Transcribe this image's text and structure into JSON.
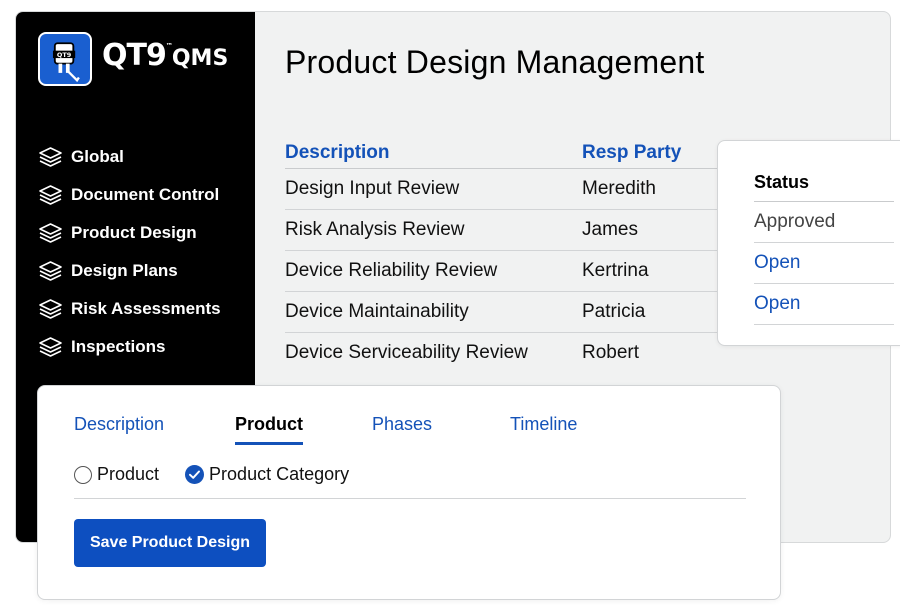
{
  "brand": {
    "logo_name": "QT9",
    "logo_suffix": "QMS",
    "trademark": "™",
    "badge_text": "QT9",
    "accent_color": "#1a5fd0"
  },
  "sidebar": {
    "items": [
      {
        "label": "Global",
        "icon": "layers-icon"
      },
      {
        "label": "Document Control",
        "icon": "layers-icon"
      },
      {
        "label": "Product Design",
        "icon": "layers-icon"
      },
      {
        "label": "Design Plans",
        "icon": "layers-icon"
      },
      {
        "label": "Risk Assessments",
        "icon": "layers-icon"
      },
      {
        "label": "Inspections",
        "icon": "layers-icon"
      }
    ]
  },
  "main": {
    "title": "Product Design Management",
    "table": {
      "headers": [
        "Description",
        "Resp Party"
      ],
      "rows": [
        {
          "description": "Design Input Review",
          "resp_party": "Meredith"
        },
        {
          "description": "Risk Analysis Review",
          "resp_party": "James"
        },
        {
          "description": "Device Reliability Review",
          "resp_party": "Kertrina"
        },
        {
          "description": "Device Maintainability",
          "resp_party": "Patricia"
        },
        {
          "description": "Device Serviceability Review",
          "resp_party": "Robert"
        }
      ]
    }
  },
  "status_panel": {
    "header": "Status",
    "items": [
      "Approved",
      "Open",
      "Open"
    ]
  },
  "bottom_panel": {
    "tabs": [
      {
        "label": "Description",
        "active": false
      },
      {
        "label": "Product",
        "active": true
      },
      {
        "label": "Phases",
        "active": false
      },
      {
        "label": "Timeline",
        "active": false
      }
    ],
    "radios": [
      {
        "label": "Product",
        "checked": false
      },
      {
        "label": "Product Category",
        "checked": true
      }
    ],
    "save_label": "Save Product Design"
  },
  "colors": {
    "link_blue": "#1452b8",
    "button_blue": "#0d4fc0",
    "sidebar_bg": "#000000",
    "content_bg": "#f1f2f2"
  }
}
